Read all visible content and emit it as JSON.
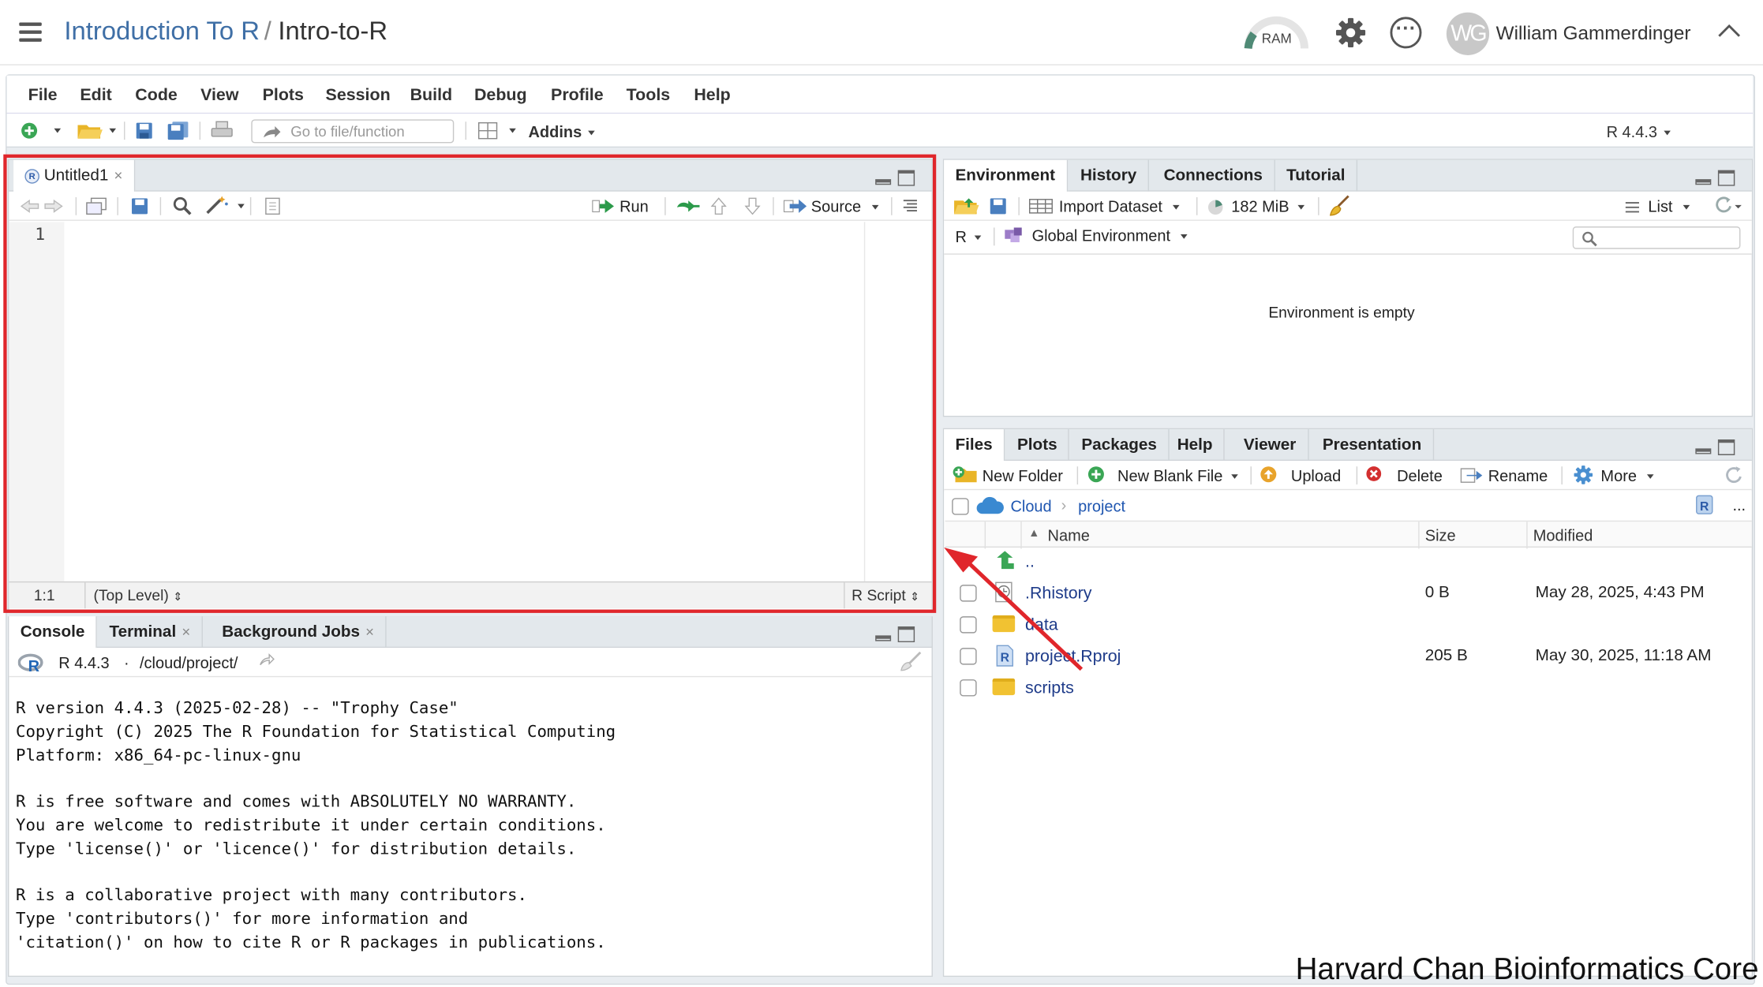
{
  "header": {
    "project": "Introduction To R",
    "separator": "/",
    "name": "Intro-to-R",
    "ram_label": "RAM",
    "avatar_initials": "WG",
    "user": "William Gammerdinger"
  },
  "menu": [
    "File",
    "Edit",
    "Code",
    "View",
    "Plots",
    "Session",
    "Build",
    "Debug",
    "Profile",
    "Tools",
    "Help"
  ],
  "toolbar": {
    "goto_placeholder": "Go to file/function",
    "addins": "Addins",
    "r_version": "R 4.4.3"
  },
  "editor": {
    "tab": "Untitled1",
    "run": "Run",
    "source": "Source",
    "line_number": "1",
    "cursor": "1:1",
    "scope": "(Top Level)",
    "filetype": "R Script"
  },
  "console": {
    "tabs": [
      "Console",
      "Terminal",
      "Background Jobs"
    ],
    "version": "R 4.4.3",
    "dot": "·",
    "path": "/cloud/project/",
    "text": "R version 4.4.3 (2025-02-28) -- \"Trophy Case\"\nCopyright (C) 2025 The R Foundation for Statistical Computing\nPlatform: x86_64-pc-linux-gnu\n\nR is free software and comes with ABSOLUTELY NO WARRANTY.\nYou are welcome to redistribute it under certain conditions.\nType 'license()' or 'licence()' for distribution details.\n\nR is a collaborative project with many contributors.\nType 'contributors()' for more information and\n'citation()' on how to cite R or R packages in publications."
  },
  "environment": {
    "tabs": [
      "Environment",
      "History",
      "Connections",
      "Tutorial"
    ],
    "import_dataset": "Import Dataset",
    "memory": "182 MiB",
    "list": "List",
    "lang": "R",
    "scope": "Global Environment",
    "empty": "Environment is empty"
  },
  "files": {
    "tabs": [
      "Files",
      "Plots",
      "Packages",
      "Help",
      "Viewer",
      "Presentation"
    ],
    "new_folder": "New Folder",
    "new_blank_file": "New Blank File",
    "upload": "Upload",
    "delete": "Delete",
    "rename": "Rename",
    "more": "More",
    "path_root": "Cloud",
    "path_sub": "project",
    "more_dots": "...",
    "columns": {
      "name": "Name",
      "size": "Size",
      "modified": "Modified"
    },
    "up": "..",
    "rows": [
      {
        "name": ".Rhistory",
        "size": "0 B",
        "modified": "May 28, 2025, 4:43 PM"
      },
      {
        "name": "data",
        "size": "",
        "modified": ""
      },
      {
        "name": "project.Rproj",
        "size": "205 B",
        "modified": "May 30, 2025, 11:18 AM"
      },
      {
        "name": "scripts",
        "size": "",
        "modified": ""
      }
    ]
  },
  "watermark": "Harvard Chan Bioinformatics Core",
  "colors": {
    "highlight": "#e0262b",
    "link": "#1f3c8a",
    "project": "#3f6fa6"
  },
  "icons": [
    "menu-icon",
    "ram-gauge-icon",
    "gear-icon",
    "more-options-icon",
    "chevron-up-icon",
    "r-logo-icon",
    "folder-icon",
    "cloud-icon",
    "up-arrow-icon"
  ]
}
